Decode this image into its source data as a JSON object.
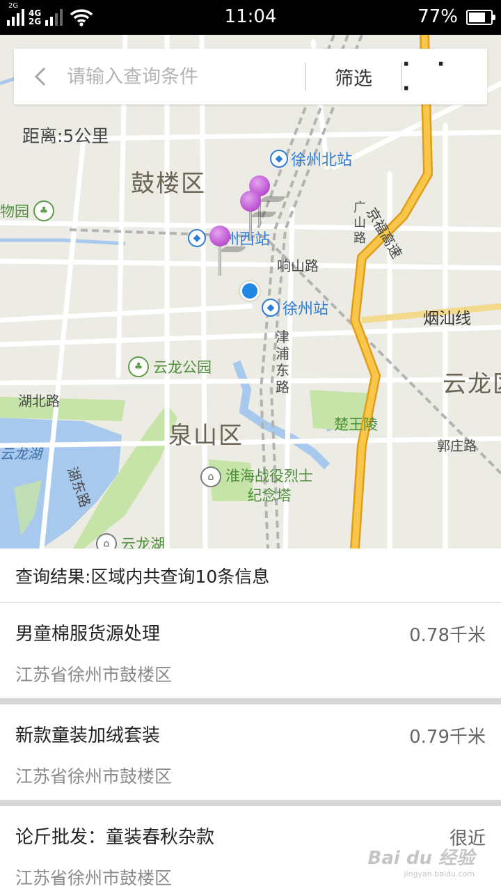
{
  "status_bar": {
    "sim1_tag": "2G",
    "net_top": "4G",
    "net_bottom": "2G",
    "time": "11:04",
    "battery_percent": "77%",
    "battery_level": 0.77
  },
  "search": {
    "placeholder": "请输入查询条件",
    "filter_label": "筛选",
    "more_label": "· · ·"
  },
  "map": {
    "distance_label": "距离:5公里",
    "districts": [
      "鼓楼区",
      "泉山区",
      "云龙区"
    ],
    "stations": [
      "徐州北站",
      "州西站",
      "徐州站"
    ],
    "roads": [
      "响山路",
      "津浦东路",
      "湖北路",
      "湖东路",
      "烟汕线",
      "京福高速",
      "广山路",
      "郭庄路"
    ],
    "pois": [
      "云龙公园",
      "楚王陵",
      "淮海战役烈士纪念塔",
      "物园",
      "云龙湖",
      "云龙湖"
    ],
    "colors": {
      "water": "#a8c9ee",
      "green": "#c6e3a8",
      "highway": "#f5b323",
      "railway": "#a0a0a0",
      "pin": "#c15ad6",
      "location": "#1f88e5"
    }
  },
  "results": {
    "summary": "查询结果:区域内共查询10条信息",
    "items": [
      {
        "title": "男童棉服货源处理",
        "distance": "0.78千米",
        "address": "江苏省徐州市鼓楼区"
      },
      {
        "title": "新款童装加绒套装",
        "distance": "0.79千米",
        "address": "江苏省徐州市鼓楼区"
      },
      {
        "title": "论斤批发：童装春秋杂款",
        "distance": "很近",
        "address": "江苏省徐州市鼓楼区"
      }
    ]
  },
  "watermark": {
    "brand": "Bai du 经验",
    "url": "jingyan.baidu.com"
  }
}
